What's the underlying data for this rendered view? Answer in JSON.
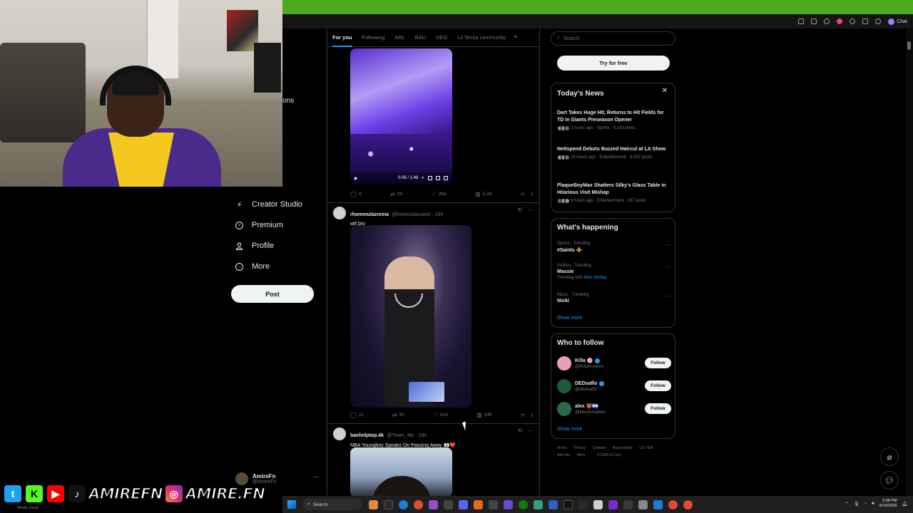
{
  "overlay": {
    "cut_text": "ons",
    "channel_handle": "AMIREFN",
    "ig_handle": "AMIRE.FN",
    "small_footer": "Mostly cloudy"
  },
  "nav": {
    "items": [
      {
        "label": "Creator Studio",
        "icon": "lightning-icon"
      },
      {
        "label": "Premium",
        "icon": "x-premium-icon"
      },
      {
        "label": "Profile",
        "icon": "person-icon"
      },
      {
        "label": "More",
        "icon": "more-circle-icon"
      }
    ],
    "post_label": "Post",
    "account_name": "AmireFn",
    "account_handle": "@AmireFn"
  },
  "tabs": [
    "For you",
    "Following",
    "ARL",
    "BAU",
    "DEO",
    "Lil Tecca community"
  ],
  "tweets": [
    {
      "video_time": "0:06 / 1:48",
      "replies": "9",
      "reposts": "29",
      "likes": "264",
      "views": "5.2K"
    },
    {
      "name": "rhommulazreina",
      "handle": "@hommulazwest · 14h",
      "text": "wtf bro",
      "replies": "11",
      "reposts": "90",
      "likes": "614",
      "views": "24K"
    },
    {
      "name": "baehelptop.4k",
      "handle": "@Team_4kt · 19h",
      "text": "NBA Youngboy Speaks On Passing Away 👀❤️"
    }
  ],
  "sidebar": {
    "search_placeholder": "Search",
    "try_label": "Try for free",
    "today_title": "Today's News",
    "news": [
      {
        "headline": "Dart Takes Huge Hit, Returns to Hit Fields for TD in Giants Preseason Opener",
        "meta": "3 hours ago · Sports · 6,183 posts"
      },
      {
        "headline": "Nettspend Debuts Buzzed Haircut at LA Show",
        "meta": "16 hours ago · Entertainment · 4,537 posts"
      },
      {
        "headline": "PlaqueBoyMax Shatters Silky's Glass Table in Hilarious Visit Mishap",
        "meta": "9 hours ago · Entertainment · 197 posts"
      }
    ],
    "happening_title": "What's happening",
    "trends": [
      {
        "category": "Sports · Trending",
        "name": "#Saints ⚜️",
        "sub": "",
        "link": ""
      },
      {
        "category": "Politics · Trending",
        "name": "Massie",
        "sub": "Trending with ",
        "link": "Nick Shirley"
      },
      {
        "category": "Music · Trending",
        "name": "Nicki",
        "sub": "",
        "link": ""
      }
    ],
    "show_more": "Show more",
    "wtf_title": "Who to follow",
    "follow": [
      {
        "name": "Killa 🌸",
        "handle": "@KillaKrewxx",
        "color": "#e8a0b4"
      },
      {
        "name": "DEDsaflo",
        "handle": "@dedsaflo",
        "color": "#1e5a3a"
      },
      {
        "name": "alex 👹🇮🇱",
        "handle": "@lifesforsaken",
        "color": "#2a6a4a"
      }
    ],
    "follow_label": "Follow",
    "footer": [
      "Terms",
      "Privacy",
      "Cookies",
      "Accessibility",
      "US TIDA",
      "Ads info",
      "More ···",
      "© 2026 X Corp."
    ]
  },
  "browser": {
    "chat_label": "Chat"
  },
  "taskbar": {
    "search_label": "Search",
    "time": "3:38 PM",
    "date": "8/15/2026"
  },
  "colors": {
    "accent": "#1d9bf0",
    "chrome_green": "#4ea81e",
    "border": "#2f3336"
  }
}
